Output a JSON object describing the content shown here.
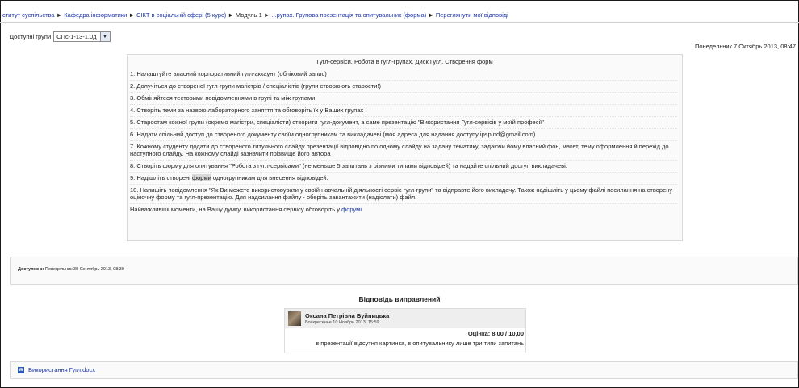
{
  "breadcrumb": [
    {
      "label": "ститут суспільства"
    },
    {
      "label": "Кафедра інформатики"
    },
    {
      "label": "СІКТ в соціальній сфері (5 курс)"
    },
    {
      "label": "Модуль 1"
    },
    {
      "label": "...рупах. Групова презентація та опитувальник (форма)"
    },
    {
      "label": "Переглянути мої відповіді"
    }
  ],
  "separator": "►",
  "groups": {
    "label": "Доступні групи",
    "selected": "СПс-1-13-1.0д"
  },
  "current_date": "Понедельник 7 Октябрь 2013, 08:47",
  "assignment": {
    "title": "Гугл-сервіси. Робота в гугл-групах. Диск Гугл. Створення форм",
    "items": [
      "1. Налаштуйте власний корпоративний гугл-аккаунт (обліковий запис)",
      "2. Долучіться до створеної гугл-групи магістрів / спеціалістів (групи створюють старости!)",
      "3. Обміняйтеся тестовими повідомленнями в групі та між групами",
      "4. Створіть теми за назвою лабораторного заняття та обговоріть їх у Ваших групах",
      "5. Старостам кожної групи (окремо магістри, спеціалісти) створити гугл-документ, а саме презентацію \"Використання Гугл-сервісів у моїй професії\"",
      "6. Надати спільний доступ до створеного документу своїм одногрупникам та викладачеві (моя  адреса для надання доступу ipsp.nd@gmail.com)",
      "7. Кожному студенту додати до створеного титульного слайду презентації відповідно по одному слайду на задану тематику, задаючи йому власний фон, макет, тему оформлення й перехід до наступного слайду. На кожному слайді зазначити прізвище його автора",
      "8. Створіть форму для опитування \"Робота з гугл-сервісами\" (не меньше 5 запитань з різними типами відповідей) та надайте спільний доступ викладачеві.",
      {
        "before": "9. Надішліть створені ",
        "highlight": "форми",
        "after": " одногрупникам для внесення відповідей."
      },
      "10. Напишіть повідомлення \"Як Ви можете використовувати у своїй навчальній діяльності  сервіс гугл-групи\" та відправте його викладачу. Також надішліть у цьому файлі посилання на створену оціночну форму та гугл-презентацію. Для надсилання файлу - оберіть завантажити (надіслати) файл."
    ],
    "footer_text": "Найважливіші моменти, на Вашу думку, використання сервісу обговоріть у ",
    "footer_link": "форумі"
  },
  "available": {
    "label": "Доступно з:",
    "value": "Понедельник 30 Сентябрь 2013, 08:30"
  },
  "feedback": {
    "title": "Відповідь виправлений",
    "author": "Оксана Петрівна Буйницька",
    "date": "Воскресенье 10 Ноябрь 2013, 15:59",
    "grade": "Оцінка: 8,00 / 10,00",
    "comment": "в презентації відсутня картинка, в опитувальнику лише три типи запитань"
  },
  "attachment": {
    "icon": "word-icon",
    "icon_letter": "W",
    "filename": "Використання Гугл.docx"
  },
  "colors": {
    "link": "#1a34a6",
    "box_bg": "#fafafa",
    "border": "#d9d9d9"
  }
}
